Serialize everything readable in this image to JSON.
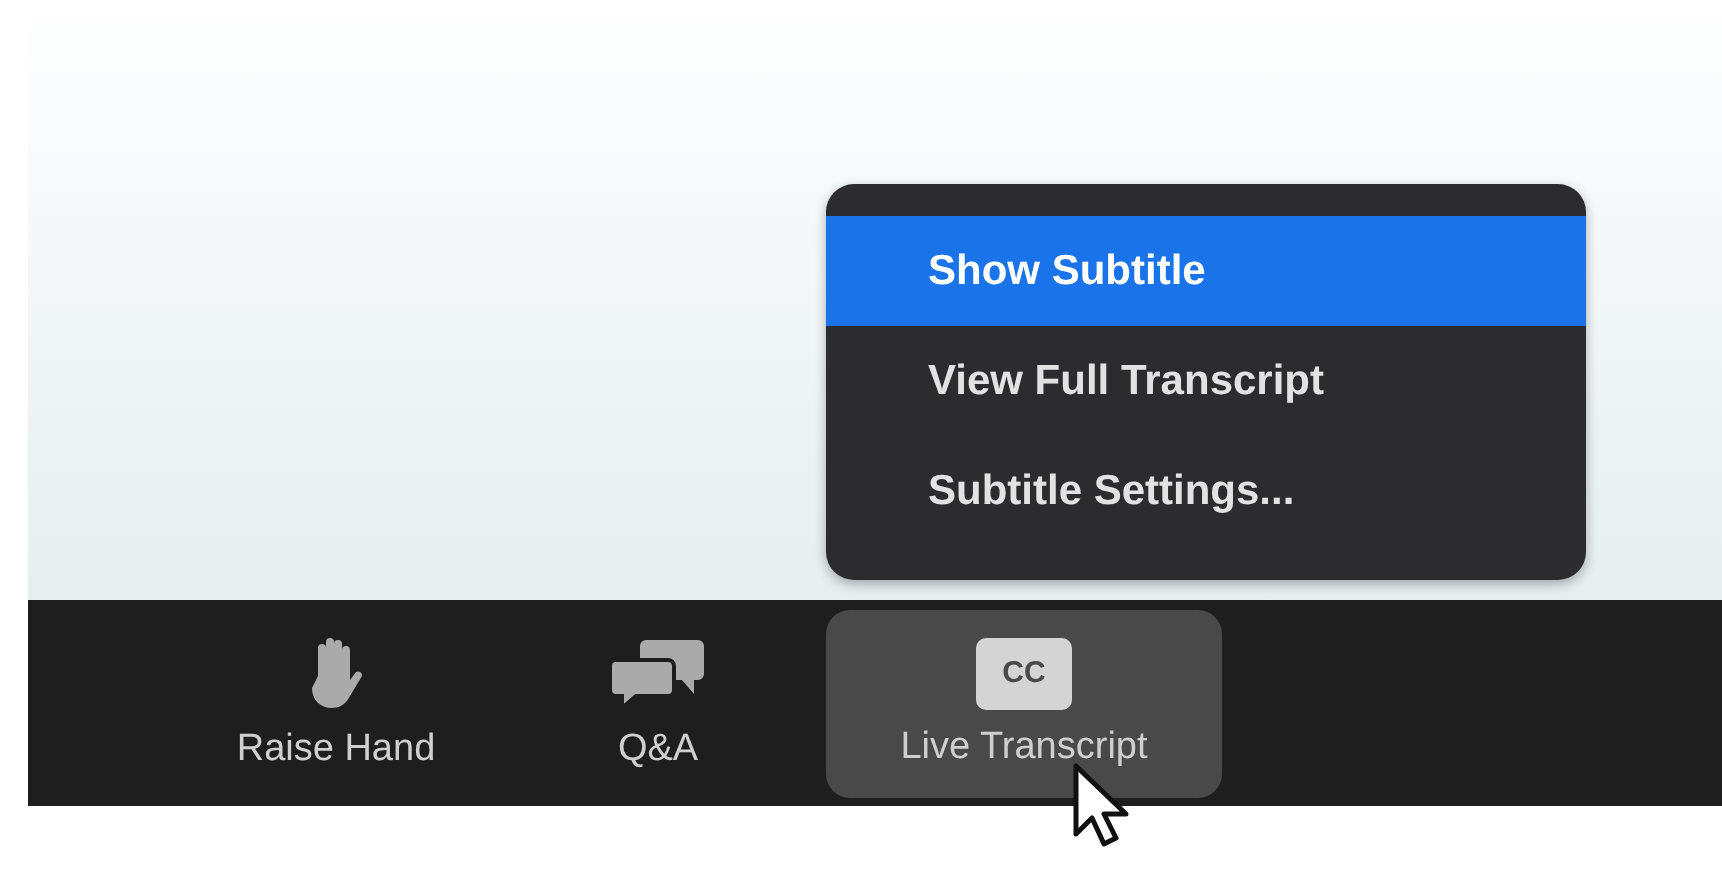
{
  "menu": {
    "items": [
      {
        "label": "Show Subtitle",
        "selected": true
      },
      {
        "label": "View Full Transcript",
        "selected": false
      },
      {
        "label": "Subtitle Settings...",
        "selected": false
      }
    ]
  },
  "toolbar": {
    "items": [
      {
        "label": "Raise Hand",
        "kind": "hand",
        "selected": false
      },
      {
        "label": "Q&A",
        "kind": "chat",
        "selected": false
      },
      {
        "label": "Live Transcript",
        "kind": "cc",
        "badge": "CC",
        "selected": true
      }
    ]
  }
}
